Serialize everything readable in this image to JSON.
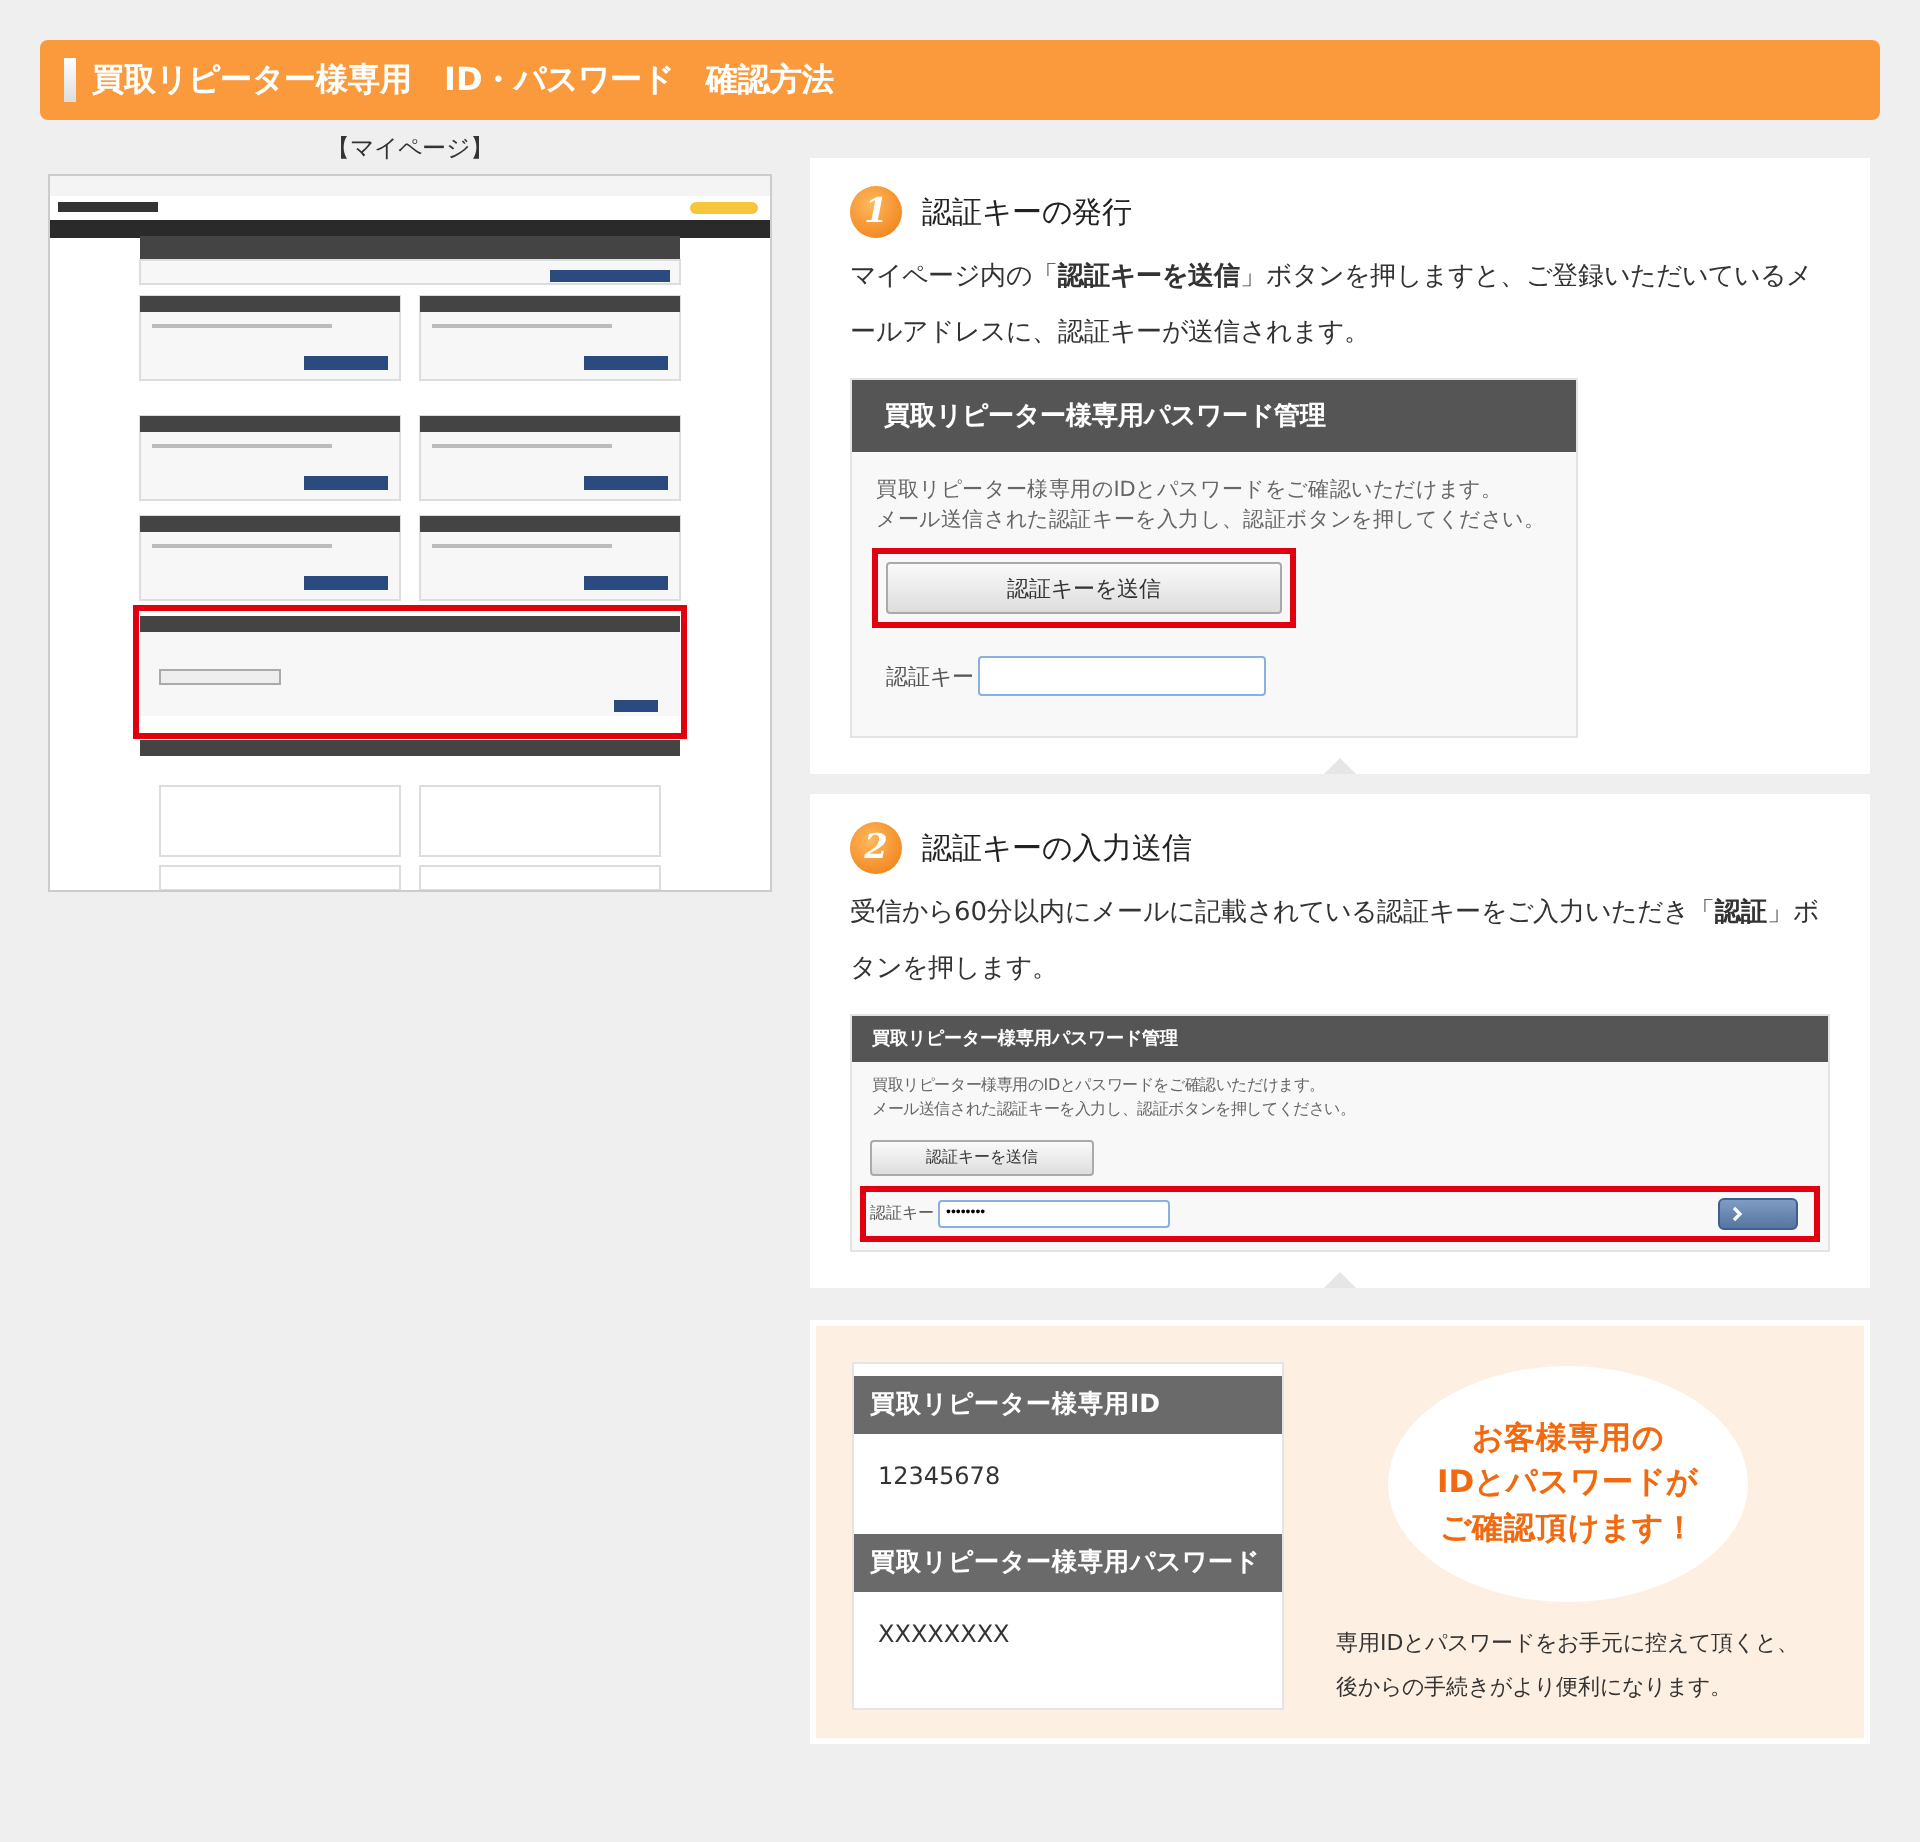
{
  "header": {
    "title": "買取リピーター様専用　ID・パスワード　確認方法"
  },
  "mypage": {
    "caption": "【マイページ】"
  },
  "steps": [
    {
      "number": "1",
      "title": "認証キーの発行",
      "text": "マイページ内の「**認証キーを送信**」ボタンを押しますと、ご登録いただいているメールアドレスに、認証キーが送信されます。",
      "panel": {
        "kind": "large",
        "title": "買取リピーター様専用パスワード管理",
        "lines": [
          "買取リピーター様専用のIDとパスワードをご確認いただけます。",
          "メール送信された認証キーを入力し、認証ボタンを押してください。"
        ],
        "send_button": "認証キーを送信",
        "key_label": "認証キー",
        "send_highlighted": true,
        "key_highlighted": false
      }
    },
    {
      "number": "2",
      "title": "認証キーの入力送信",
      "text": "受信から60分以内にメールに記載されている認証キーをご入力いただき「**認証**」ボタンを押します。",
      "panel": {
        "kind": "small",
        "title": "買取リピーター様専用パスワード管理",
        "lines": [
          "買取リピーター様専用のIDとパスワードをご確認いただけます。",
          "メール送信された認証キーを入力し、認証ボタンを押してください。"
        ],
        "send_button": "認証キーを送信",
        "key_label": "認証キー",
        "key_value": "••••••••",
        "send_highlighted": false,
        "key_highlighted": true
      }
    }
  ],
  "result": {
    "fields": [
      {
        "label": "買取リピーター様専用ID",
        "value": "12345678"
      },
      {
        "label": "買取リピーター様専用パスワード",
        "value": "XXXXXXXX"
      }
    ],
    "callout": [
      "お客様専用の",
      "IDとパスワードが",
      "ご確認頂けます！"
    ],
    "note": [
      "専用IDとパスワードをお手元に控えて頂くと、",
      "後からの手続きがより便利になります。"
    ]
  }
}
